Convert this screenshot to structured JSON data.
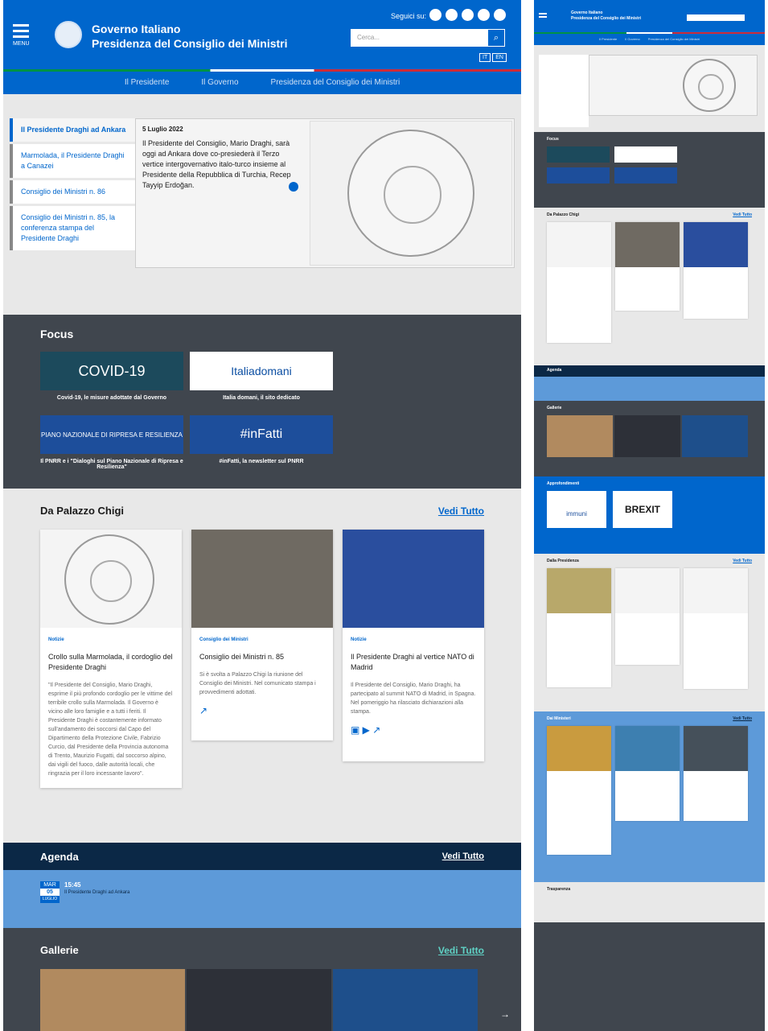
{
  "header": {
    "menu_label": "MENU",
    "title_line1": "Governo Italiano",
    "title_line2": "Presidenza del Consiglio dei Ministri",
    "follow_label": "Seguici su:",
    "search_placeholder": "Cerca...",
    "lang_it": "IT",
    "lang_en": "EN"
  },
  "nav": [
    "Il Presidente",
    "Il Governo",
    "Presidenza del Consiglio dei Ministri"
  ],
  "hero": {
    "items": [
      "Il Presidente Draghi ad Ankara",
      "Marmolada, il Presidente Draghi a Canazei",
      "Consiglio dei Ministri n. 86",
      "Consiglio dei Ministri n. 85, la conferenza stampa del Presidente Draghi"
    ],
    "date": "5 Luglio 2022",
    "text": "Il Presidente del Consiglio, Mario Draghi, sarà oggi ad Ankara dove co-presiederà il Terzo vertice intergovernativo italo-turco insieme al Presidente della Repubblica di Turchia, Recep Tayyip Erdoğan."
  },
  "focus": {
    "title": "Focus",
    "items": [
      {
        "banner": "COVID-19",
        "caption": "Covid-19, le misure adottate dal Governo"
      },
      {
        "banner": "Italiadomani",
        "caption": "Italia domani, il sito dedicato"
      },
      {
        "banner": "PIANO NAZIONALE DI RIPRESA E RESILIENZA",
        "caption": "Il PNRR e i \"Dialoghi sul Piano Nazionale di Ripresa e Resilienza\""
      },
      {
        "banner": "#inFatti",
        "caption": "#inFatti, la newsletter sul PNRR"
      }
    ]
  },
  "palazzo": {
    "title": "Da Palazzo Chigi",
    "see_all": "Vedi Tutto",
    "cards": [
      {
        "category": "Notizie",
        "title": "Crollo sulla Marmolada, il cordoglio del Presidente Draghi",
        "desc": "\"Il Presidente del Consiglio, Mario Draghi, esprime il più profondo cordoglio per le vittime del terribile crollo sulla Marmolada. Il Governo è vicino alle loro famiglie e a tutti i feriti. Il Presidente Draghi è costantemente informato sull'andamento dei soccorsi dal Capo del Dipartimento della Protezione Civile, Fabrizio Curcio, dal Presidente della Provincia autonoma di Trento, Maurizio Fugatti, dal soccorso alpino, dai vigili del fuoco, dalle autorità locali, che ringrazia per il loro incessante lavoro\"."
      },
      {
        "category": "Consiglio dei Ministri",
        "title": "Consiglio dei Ministri n. 85",
        "desc": "Si è svolta a Palazzo Chigi la riunione del Consiglio dei Ministri. Nel comunicato stampa i provvedimenti adottati."
      },
      {
        "category": "Notizie",
        "title": "Il Presidente Draghi al vertice NATO di Madrid",
        "desc": "Il Presidente del Consiglio, Mario Draghi, ha partecipato al summit NATO di Madrid, in Spagna. Nel pomeriggio ha rilasciato dichiarazioni alla stampa."
      }
    ]
  },
  "agenda": {
    "title": "Agenda",
    "see_all": "Vedi Tutto",
    "month": "MAR",
    "day": "05",
    "month_full": "LUGLIO",
    "time": "15:45",
    "event": "Il Presidente Draghi ad Ankara"
  },
  "gallery": {
    "title": "Gallerie",
    "see_all": "Vedi Tutto"
  },
  "right": {
    "focus": "Focus",
    "palazzo": "Da Palazzo Chigi",
    "agenda": "Agenda",
    "gallerie": "Gallerie",
    "approfondimenti": "Approfondimenti",
    "presidenza": "Dalla Presidenza",
    "ministri": "Dai Ministeri",
    "trasparenza": "Trasparenza",
    "see_all": "Vedi Tutto",
    "immuni": "immuni",
    "brexit": "BREXIT"
  },
  "colors": {
    "primary": "#0066cc",
    "dark": "#40464e",
    "navy": "#0b2846",
    "agenda_bg": "#5d9ad9"
  }
}
